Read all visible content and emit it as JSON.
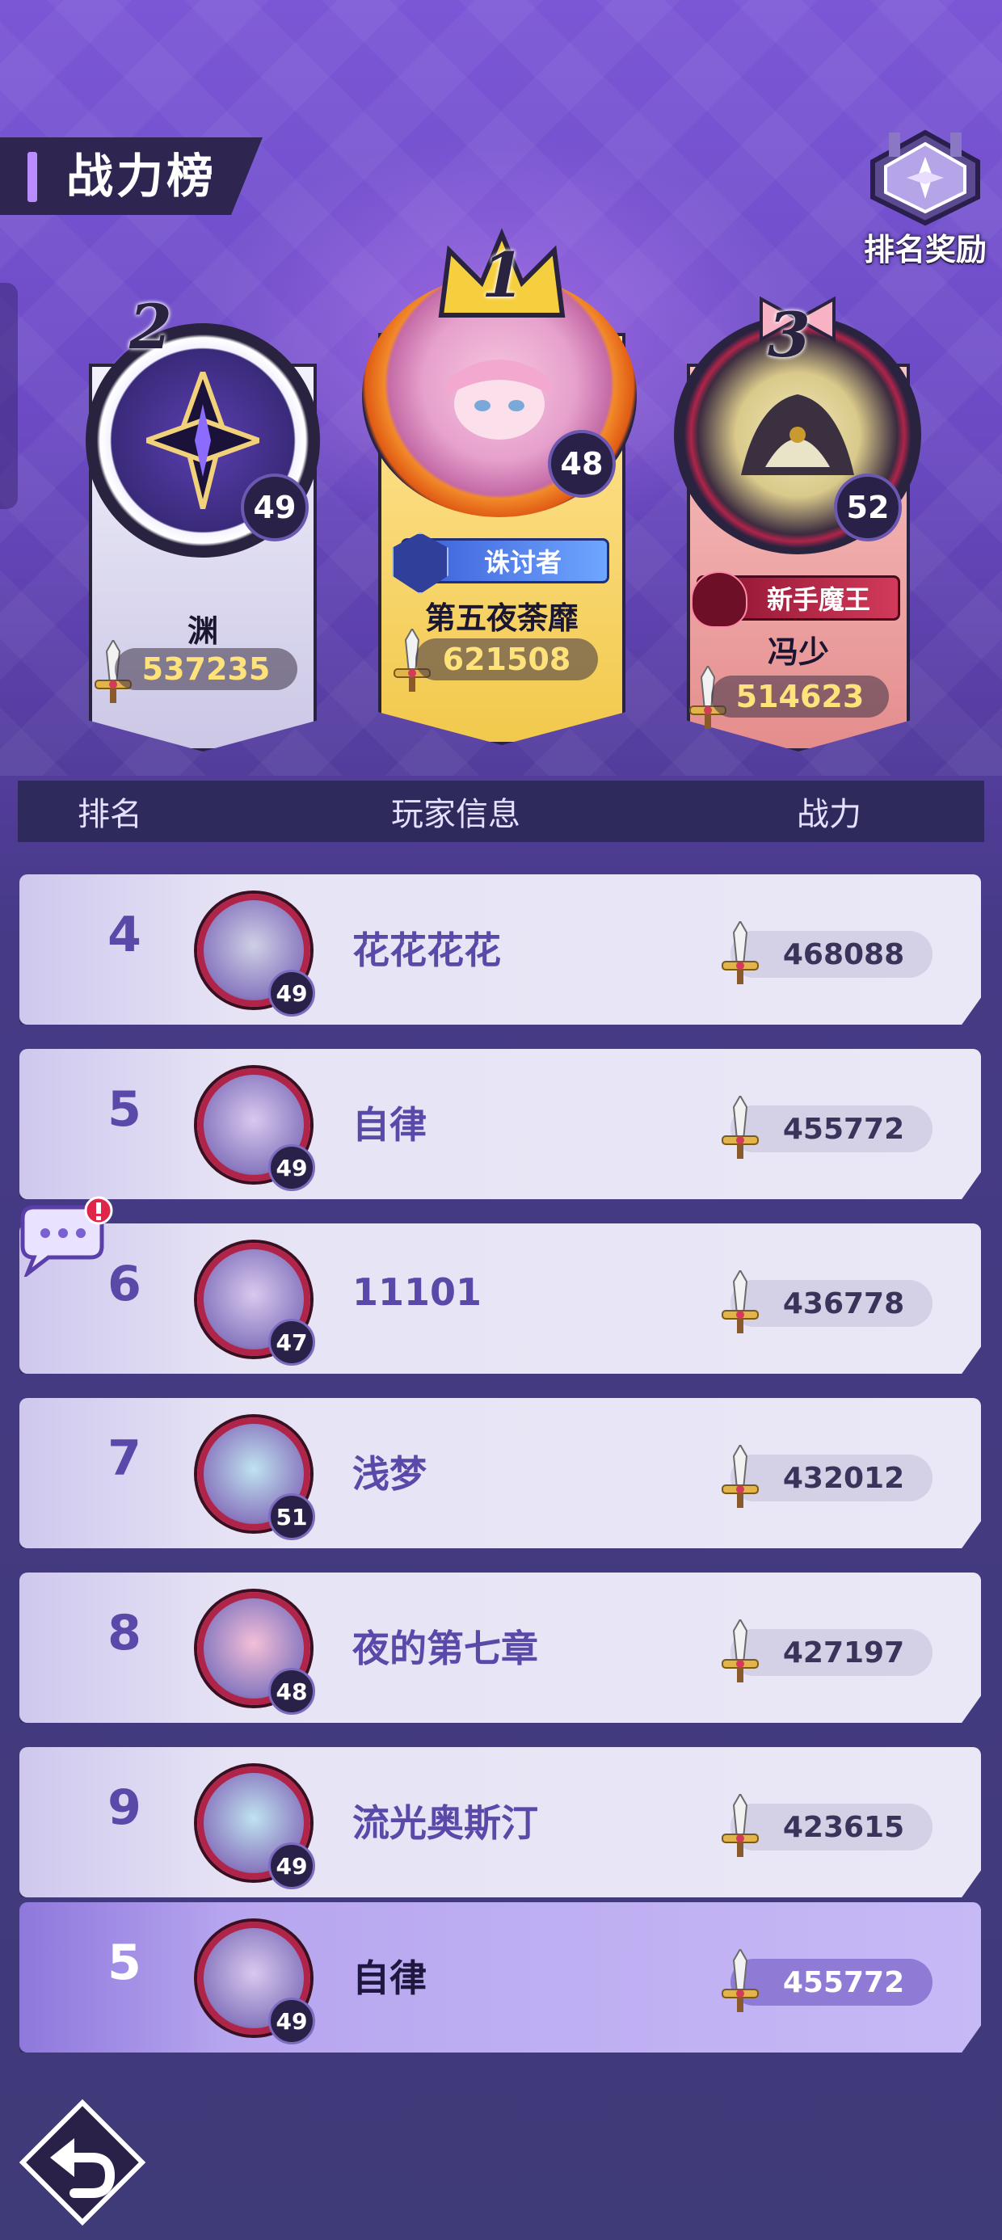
{
  "header": {
    "title": "战力榜",
    "reward_label": "排名奖励"
  },
  "podium": [
    {
      "rank": "1",
      "name": "第五夜荼靡",
      "power": "621508",
      "level": "48",
      "title": "诛讨者"
    },
    {
      "rank": "2",
      "name": "渊",
      "power": "537235",
      "level": "49"
    },
    {
      "rank": "3",
      "name": "冯少",
      "power": "514623",
      "level": "52",
      "title": "新手魔王"
    }
  ],
  "table": {
    "columns": [
      "排名",
      "玩家信息",
      "战力"
    ],
    "rows": [
      {
        "rank": "4",
        "name": "花花花花",
        "level": "49",
        "power": "468088"
      },
      {
        "rank": "5",
        "name": "自律",
        "level": "49",
        "power": "455772"
      },
      {
        "rank": "6",
        "name": "11101",
        "level": "47",
        "power": "436778"
      },
      {
        "rank": "7",
        "name": "浅梦",
        "level": "51",
        "power": "432012"
      },
      {
        "rank": "8",
        "name": "夜的第七章",
        "level": "48",
        "power": "427197"
      },
      {
        "rank": "9",
        "name": "流光奥斯汀",
        "level": "49",
        "power": "423615"
      }
    ]
  },
  "my_rank": {
    "rank": "5",
    "name": "自律",
    "level": "49",
    "power": "455772"
  },
  "icons": {
    "reward": "trophy-crest-icon",
    "power": "sword-icon",
    "chat": "chat-bubble-icon",
    "back": "back-arrow-icon"
  },
  "colors": {
    "accent": "#b98cff",
    "gold": "#f3d36b",
    "silver": "#d9d6ef",
    "bronze": "#f0a3a3",
    "power_text": "#ffe27a"
  }
}
